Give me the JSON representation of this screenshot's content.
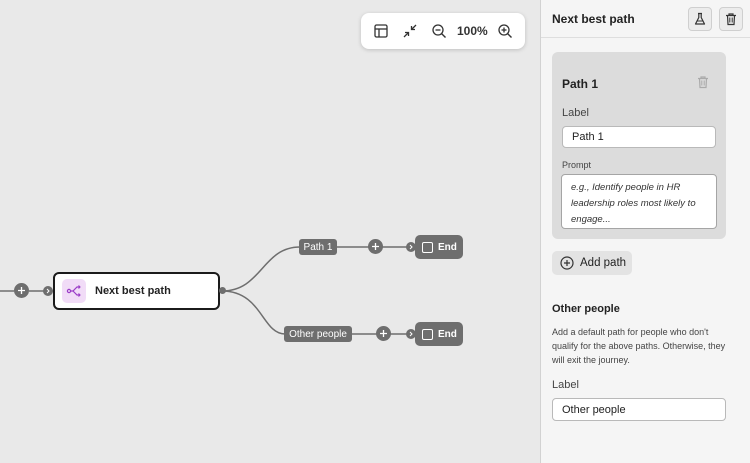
{
  "canvas": {
    "zoom_level": "100%",
    "main_node_label": "Next best path",
    "paths": [
      {
        "label": "Path 1",
        "end_label": "End"
      },
      {
        "label": "Other people",
        "end_label": "End"
      }
    ]
  },
  "panel": {
    "title": "Next best path",
    "path_card": {
      "title": "Path 1",
      "label_heading": "Label",
      "label_value": "Path 1",
      "prompt_heading": "Prompt",
      "prompt_placeholder": "e.g., Identify people in HR leadership roles most likely to engage..."
    },
    "add_path_label": "Add path",
    "other_people": {
      "title": "Other people",
      "description": "Add a default path for people who don't qualify for the above paths. Otherwise, they will exit the journey.",
      "label_heading": "Label",
      "label_value": "Other people"
    }
  },
  "colors": {
    "canvas_bg": "#e9e9e9",
    "node_gray": "#6e6e6e",
    "node_icon_bg": "#f1dcf7",
    "node_icon_accent": "#9a3cc7"
  }
}
